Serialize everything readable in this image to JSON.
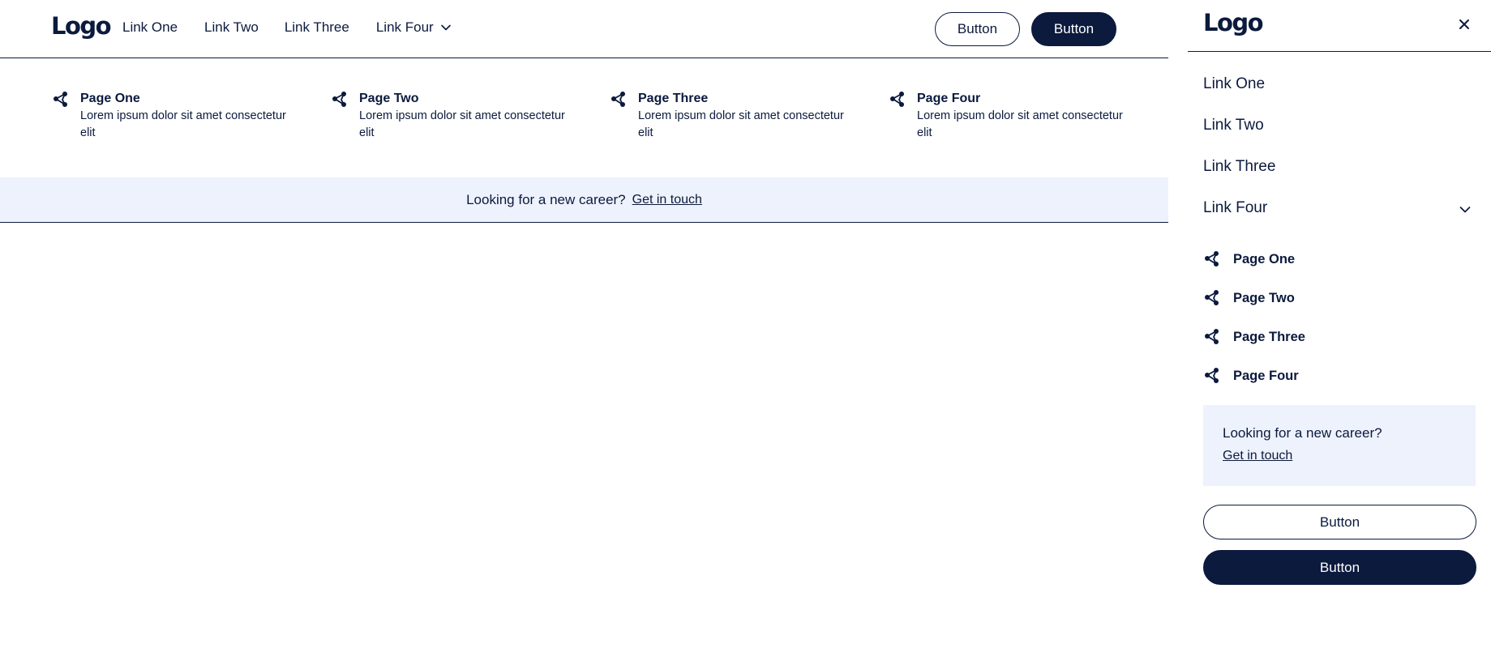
{
  "desktop": {
    "logo": "Logo",
    "nav": [
      "Link One",
      "Link Two",
      "Link Three",
      "Link Four"
    ],
    "buttons": {
      "secondary": "Button",
      "primary": "Button"
    },
    "mega_menu": [
      {
        "title": "Page One",
        "desc": "Lorem ipsum dolor sit amet consectetur elit"
      },
      {
        "title": "Page Two",
        "desc": "Lorem ipsum dolor sit amet consectetur elit"
      },
      {
        "title": "Page Three",
        "desc": "Lorem ipsum dolor sit amet consectetur elit"
      },
      {
        "title": "Page Four",
        "desc": "Lorem ipsum dolor sit amet consectetur elit"
      }
    ],
    "banner": {
      "text": "Looking for a new career?",
      "link": "Get in touch"
    }
  },
  "mobile": {
    "logo": "Logo",
    "nav": [
      "Link One",
      "Link Two",
      "Link Three",
      "Link Four"
    ],
    "pages": [
      "Page One",
      "Page Two",
      "Page Three",
      "Page Four"
    ],
    "card": {
      "text": "Looking for a new career?",
      "link": "Get in touch"
    },
    "buttons": {
      "secondary": "Button",
      "primary": "Button"
    }
  },
  "icons": {
    "page": "share-nodes-icon",
    "dropdown": "chevron-down-icon",
    "close": "close-icon"
  },
  "colors": {
    "primary": "#0b1a3d",
    "banner_bg": "#eef2fc"
  }
}
